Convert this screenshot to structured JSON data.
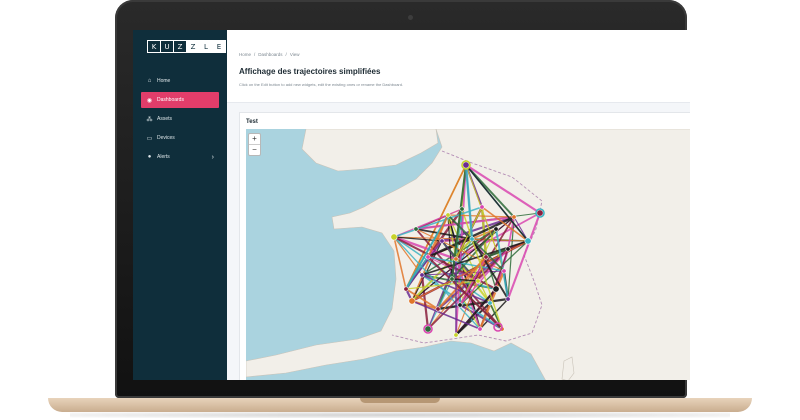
{
  "logo": {
    "letters": [
      "K",
      "U",
      "Z",
      "Z",
      "L",
      "E"
    ]
  },
  "sidebar": {
    "items": [
      {
        "label": "Home",
        "icon": "home-icon",
        "active": false
      },
      {
        "label": "Dashboards",
        "icon": "dashboard-icon",
        "active": true
      },
      {
        "label": "Assets",
        "icon": "assets-icon",
        "active": false
      },
      {
        "label": "Devices",
        "icon": "devices-icon",
        "active": false
      },
      {
        "label": "Alerts",
        "icon": "alerts-icon",
        "active": false
      }
    ]
  },
  "breadcrumb": {
    "items": [
      "Home",
      "Dashboards",
      "View"
    ],
    "separator": "/"
  },
  "page": {
    "title": "Affichage des trajectoires simplifiées",
    "subtitle": "Click on the Edit button to add new widgets, edit the existing ones or rename the Dashboard."
  },
  "widget": {
    "title": "Test"
  },
  "map": {
    "zoom_in": "+",
    "zoom_out": "−"
  },
  "colors": {
    "sidebar": "#0f2e3b",
    "accent": "#e23d6a",
    "sea": "#aad3df",
    "land": "#f2efe9",
    "trajectories": [
      "#6b2c91",
      "#d946b0",
      "#1a1a1a",
      "#2e6b3a",
      "#e0762a",
      "#3bb3c3",
      "#c7d22a",
      "#8a1f3d"
    ]
  }
}
